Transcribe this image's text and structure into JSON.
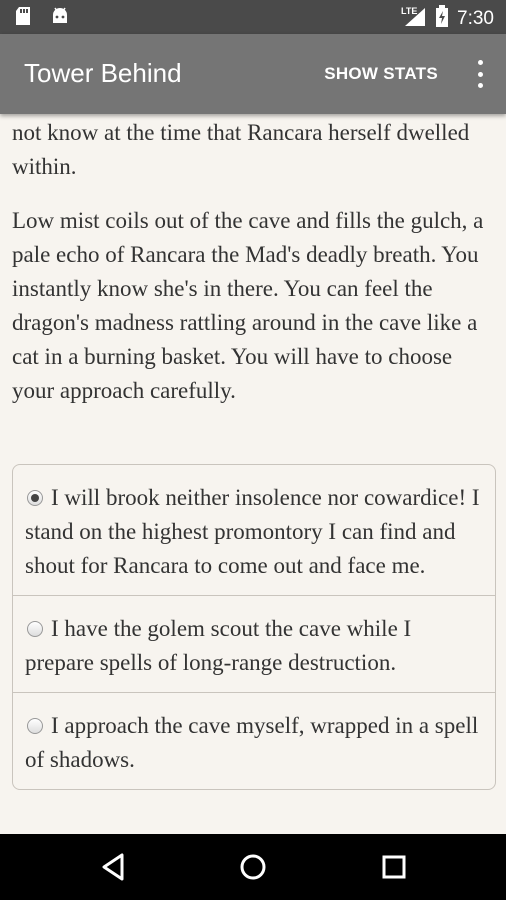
{
  "status_bar": {
    "time": "7:30",
    "network_label": "LTE",
    "left_icons": [
      "sd-card-icon",
      "android-icon"
    ],
    "right_icons": [
      "signal-icon",
      "battery-icon"
    ]
  },
  "app_bar": {
    "title": "Tower Behind",
    "action_label": "SHOW STATS",
    "overflow_icon": "more-vert-icon"
  },
  "story": {
    "paragraphs": [
      "not know at the time that Rancara herself dwelled within.",
      "Low mist coils out of the cave and fills the gulch, a pale echo of Rancara the Mad's deadly breath. You instantly know she's in there. You can feel the dragon's madness rattling around in the cave like a cat in a burning basket. You will have to choose your approach carefully."
    ]
  },
  "choices": [
    {
      "label": "I will brook neither insolence nor cowardice! I stand on the highest promontory I can find and shout for Rancara to come out and face me.",
      "selected": true
    },
    {
      "label": "I have the golem scout the cave while I prepare spells of long-range destruction.",
      "selected": false
    },
    {
      "label": "I approach the cave myself, wrapped in a spell of shadows.",
      "selected": false
    }
  ],
  "nav_bar": {
    "icons": [
      "back-icon",
      "home-icon",
      "recents-icon"
    ]
  },
  "colors": {
    "status_bar": "#4a4a4a",
    "app_bar": "#757575",
    "background": "#f7f4ef",
    "text": "#333333",
    "nav_bar": "#000000"
  }
}
